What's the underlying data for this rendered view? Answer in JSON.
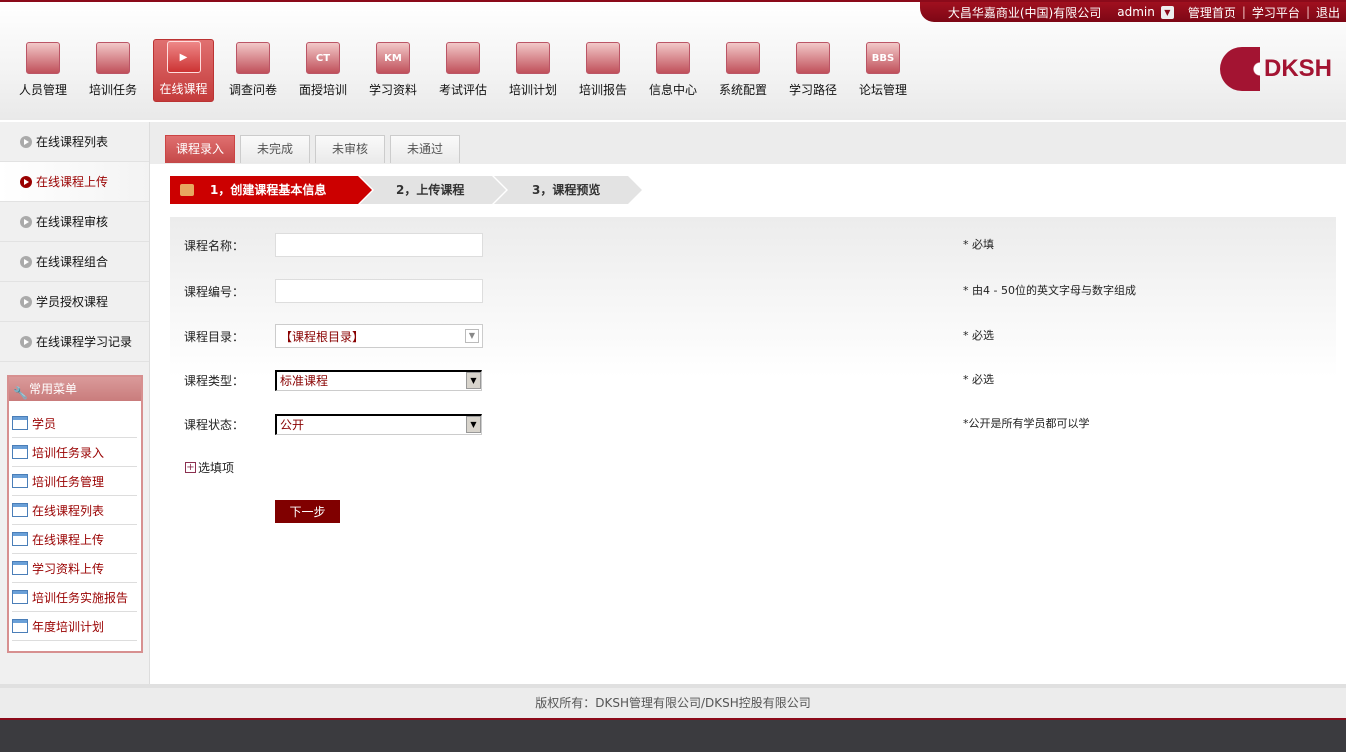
{
  "topbar": {
    "company": "大昌华嘉商业(中国)有限公司",
    "user": "admin",
    "links": [
      "管理首页",
      "学习平台",
      "退出"
    ]
  },
  "nav": [
    {
      "label": "人员管理",
      "icon": "people-icon"
    },
    {
      "label": "培训任务",
      "icon": "calendar-icon"
    },
    {
      "label": "在线课程",
      "icon": "video-icon",
      "active": true
    },
    {
      "label": "调查问卷",
      "icon": "survey-icon"
    },
    {
      "label": "面授培训",
      "icon": "ct-icon",
      "text": "CT"
    },
    {
      "label": "学习资料",
      "icon": "km-icon",
      "text": "KM"
    },
    {
      "label": "考试评估",
      "icon": "exam-icon"
    },
    {
      "label": "培训计划",
      "icon": "plan-icon"
    },
    {
      "label": "培训报告",
      "icon": "report-icon"
    },
    {
      "label": "信息中心",
      "icon": "info-icon"
    },
    {
      "label": "系统配置",
      "icon": "config-icon"
    },
    {
      "label": "学习路径",
      "icon": "path-icon"
    },
    {
      "label": "论坛管理",
      "icon": "bbs-icon",
      "text": "BBS"
    }
  ],
  "logo": "DKSH",
  "sidebar": {
    "items": [
      "在线课程列表",
      "在线课程上传",
      "在线课程审核",
      "在线课程组合",
      "学员授权课程",
      "在线课程学习记录"
    ],
    "common_title": "常用菜单",
    "common": [
      "学员",
      "培训任务录入",
      "培训任务管理",
      "在线课程列表",
      "在线课程上传",
      "学习资料上传",
      "培训任务实施报告",
      "年度培训计划"
    ]
  },
  "tabs": [
    "课程录入",
    "未完成",
    "未审核",
    "未通过"
  ],
  "steps": [
    "1，创建课程基本信息",
    "2，上传课程",
    "3，课程预览"
  ],
  "form": {
    "name_label": "课程名称：",
    "name_value": "",
    "name_note": "* 必填",
    "code_label": "课程编号：",
    "code_value": "",
    "code_note": "* 由4 - 50位的英文字母与数字组成",
    "dir_label": "课程目录：",
    "dir_value": "【课程根目录】",
    "dir_note": "* 必选",
    "type_label": "课程类型：",
    "type_value": "标准课程",
    "type_note": "* 必选",
    "status_label": "课程状态：",
    "status_value": "公开",
    "status_note": "*公开是所有学员都可以学",
    "optional": "选填项",
    "next": "下一步"
  },
  "footer": "版权所有：DKSH管理有限公司/DKSH控股有限公司",
  "colors": {
    "brand": "#8b0a1a",
    "step_active": "#cc0000",
    "button": "#800000"
  }
}
